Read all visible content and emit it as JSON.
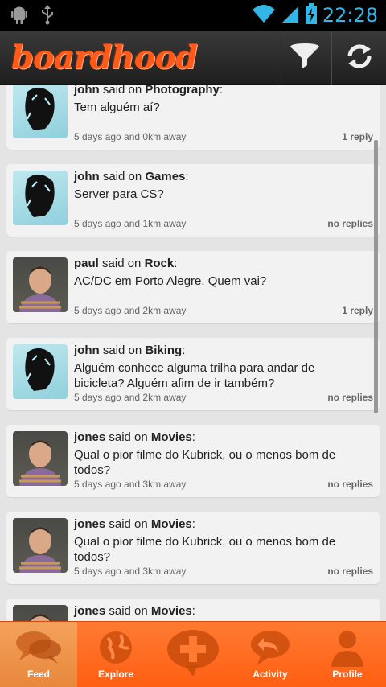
{
  "status_bar": {
    "time": "22:28"
  },
  "app": {
    "title": "boardhood"
  },
  "actions": {
    "filter_icon": "filter-icon",
    "refresh_icon": "refresh-icon"
  },
  "feed": [
    {
      "user": "john",
      "said_on": "said on",
      "board": "Photography",
      "message": "Tem alguém aí?",
      "meta": "5 days ago and 0km away",
      "replies": "1 reply",
      "avatar": "john"
    },
    {
      "user": "john",
      "said_on": "said on",
      "board": "Games",
      "message": "Server para CS?",
      "meta": "5 days ago and 1km away",
      "replies": "no replies",
      "avatar": "john"
    },
    {
      "user": "paul",
      "said_on": "said on",
      "board": "Rock",
      "message": "AC/DC em Porto Alegre. Quem vai?",
      "meta": "5 days ago and 2km away",
      "replies": "1 reply",
      "avatar": "paul"
    },
    {
      "user": "john",
      "said_on": "said on",
      "board": "Biking",
      "message": "Alguém conhece alguma trilha para andar de bicicleta? Alguém afim de ir também?",
      "meta": "5 days ago and 2km away",
      "replies": "no replies",
      "avatar": "john"
    },
    {
      "user": "jones",
      "said_on": "said on",
      "board": "Movies",
      "message": "Qual o pior filme do Kubrick, ou o menos bom de todos?",
      "meta": "5 days ago and 3km away",
      "replies": "no replies",
      "avatar": "jones"
    },
    {
      "user": "jones",
      "said_on": "said on",
      "board": "Movies",
      "message": "Qual o pior filme do Kubrick, ou o menos bom de todos?",
      "meta": "5 days ago and 3km away",
      "replies": "no replies",
      "avatar": "jones"
    },
    {
      "user": "jones",
      "said_on": "said on",
      "board": "Movies",
      "message": "",
      "meta": "",
      "replies": "",
      "avatar": "jones"
    }
  ],
  "tabs": [
    {
      "label": "Feed",
      "icon": "chat-bubbles-icon",
      "active": true
    },
    {
      "label": "Explore",
      "icon": "globe-icon",
      "active": false
    },
    {
      "label": "",
      "icon": "add-post-icon",
      "active": false
    },
    {
      "label": "Activity",
      "icon": "reply-bubble-icon",
      "active": false
    },
    {
      "label": "Profile",
      "icon": "person-icon",
      "active": false
    }
  ],
  "colors": {
    "accent": "#ff6a1f",
    "status_time": "#33b5e5",
    "actionbar": "#2a2a2a",
    "tab_active": "#eb8d42"
  }
}
